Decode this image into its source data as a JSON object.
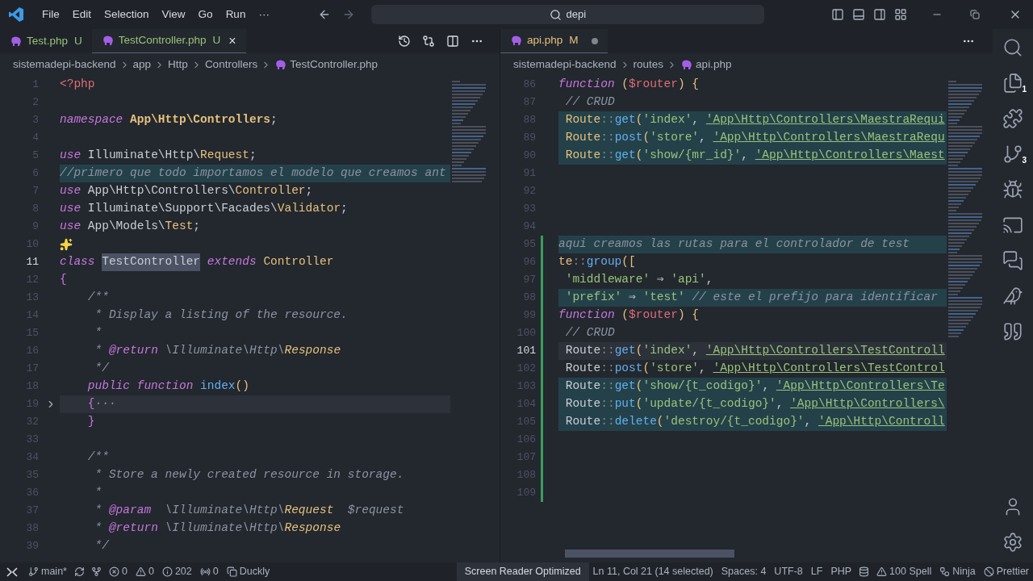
{
  "title_bar": {
    "menu": [
      "File",
      "Edit",
      "Selection",
      "View",
      "Go",
      "Run",
      "···"
    ],
    "search": "depi"
  },
  "left_editor": {
    "tabs": [
      {
        "label": "Test.php",
        "status": "U",
        "selected": false
      },
      {
        "label": "TestController.php",
        "status": "U",
        "selected": true,
        "close": "×"
      }
    ],
    "breadcrumbs": [
      "sistemadepi-backend",
      "app",
      "Http",
      "Controllers",
      "TestController.php"
    ],
    "lines": [
      {
        "number": "1",
        "kind": "code",
        "current": false,
        "highlighted": false,
        "focused": false,
        "tokens": [
          {
            "text": "<?php",
            "kind": "php"
          }
        ]
      },
      {
        "number": "2",
        "kind": "code",
        "current": false,
        "highlighted": false,
        "focused": false
      },
      {
        "number": "3",
        "kind": "code",
        "current": false,
        "highlighted": false,
        "focused": false,
        "tokens": [
          {
            "text": "namespace ",
            "kind": "kw"
          },
          {
            "text": "App\\Http\\Controllers",
            "kind": "ns"
          },
          {
            "text": ";",
            "kind": "punct"
          }
        ]
      },
      {
        "number": "4",
        "kind": "code",
        "current": false,
        "highlighted": false,
        "focused": false
      },
      {
        "number": "5",
        "kind": "code",
        "current": false,
        "highlighted": false,
        "focused": false,
        "tokens": [
          {
            "text": "use ",
            "kind": "kw"
          },
          {
            "text": "Illuminate\\Http\\",
            "kind": "plain"
          },
          {
            "text": "Request",
            "kind": "cls"
          },
          {
            "text": ";",
            "kind": "punct"
          }
        ]
      },
      {
        "number": "6",
        "kind": "code",
        "current": false,
        "highlighted": true,
        "focused": false,
        "tokens": [
          {
            "text": "//primero que todo importamos el modelo que creamos ant",
            "kind": "comment"
          }
        ]
      },
      {
        "number": "7",
        "kind": "code",
        "current": false,
        "highlighted": false,
        "focused": false,
        "tokens": [
          {
            "text": "use ",
            "kind": "kw"
          },
          {
            "text": "App\\Http\\Controllers\\",
            "kind": "plain"
          },
          {
            "text": "Controller",
            "kind": "cls"
          },
          {
            "text": ";",
            "kind": "punct"
          }
        ]
      },
      {
        "number": "8",
        "kind": "code",
        "current": false,
        "highlighted": false,
        "focused": false,
        "tokens": [
          {
            "text": "use ",
            "kind": "kw"
          },
          {
            "text": "Illuminate\\Support\\Facades\\",
            "kind": "plain"
          },
          {
            "text": "Validator",
            "kind": "cls"
          },
          {
            "text": ";",
            "kind": "punct"
          }
        ]
      },
      {
        "number": "9",
        "kind": "code",
        "current": false,
        "highlighted": false,
        "focused": false,
        "tokens": [
          {
            "text": "use ",
            "kind": "kw"
          },
          {
            "text": "App\\Models\\",
            "kind": "plain"
          },
          {
            "text": "Test",
            "kind": "cls"
          },
          {
            "text": ";",
            "kind": "punct"
          }
        ]
      },
      {
        "number": "10",
        "kind": "hint",
        "current": false,
        "highlighted": false,
        "focused": false
      },
      {
        "number": "11",
        "kind": "code",
        "current": true,
        "highlighted": false,
        "focused": false,
        "tokens": [
          {
            "text": "class ",
            "kind": "kw"
          },
          {
            "text": "TestController",
            "kind": "sel"
          },
          {
            "text": " extends ",
            "kind": "kw"
          },
          {
            "text": "Controller",
            "kind": "cls"
          }
        ]
      },
      {
        "number": "12",
        "kind": "code",
        "current": false,
        "highlighted": false,
        "focused": false,
        "tokens": [
          {
            "text": "{",
            "kind": "bracket"
          }
        ]
      },
      {
        "number": "13",
        "kind": "code",
        "current": false,
        "highlighted": false,
        "focused": false,
        "tokens": [
          {
            "text": "    /**",
            "kind": "comment"
          }
        ]
      },
      {
        "number": "14",
        "kind": "code",
        "current": false,
        "highlighted": false,
        "focused": false,
        "tokens": [
          {
            "text": "     * Display a listing of the resource.",
            "kind": "comment"
          }
        ]
      },
      {
        "number": "15",
        "kind": "code",
        "current": false,
        "highlighted": false,
        "focused": false,
        "tokens": [
          {
            "text": "     *",
            "kind": "comment"
          }
        ]
      },
      {
        "number": "16",
        "kind": "code",
        "current": false,
        "highlighted": false,
        "focused": false,
        "tokens": [
          {
            "text": "     * ",
            "kind": "comment"
          },
          {
            "text": "@return",
            "kind": "tag"
          },
          {
            "text": " \\Illuminate\\Http\\",
            "kind": "comment"
          },
          {
            "text": "Response",
            "kind": "doccls"
          }
        ]
      },
      {
        "number": "17",
        "kind": "code",
        "current": false,
        "highlighted": false,
        "focused": false,
        "tokens": [
          {
            "text": "     */",
            "kind": "comment"
          }
        ]
      },
      {
        "number": "18",
        "kind": "code",
        "current": false,
        "highlighted": false,
        "focused": false,
        "tokens": [
          {
            "text": "    public function ",
            "kind": "kw"
          },
          {
            "text": "index",
            "kind": "func"
          },
          {
            "text": "()",
            "kind": "paren"
          }
        ]
      },
      {
        "number": "19",
        "kind": "folded",
        "current": false,
        "highlighted": false,
        "focused": true,
        "tokens": [
          {
            "text": "    {",
            "kind": "bracket"
          },
          {
            "text": "···",
            "kind": "comment"
          }
        ]
      },
      {
        "number": "32",
        "kind": "code",
        "current": false,
        "highlighted": false,
        "focused": false,
        "tokens": [
          {
            "text": "    }",
            "kind": "bracket"
          }
        ]
      },
      {
        "number": "33",
        "kind": "code",
        "current": false,
        "highlighted": false,
        "focused": false
      },
      {
        "number": "34",
        "kind": "code",
        "current": false,
        "highlighted": false,
        "focused": false,
        "tokens": [
          {
            "text": "    /**",
            "kind": "comment"
          }
        ]
      },
      {
        "number": "35",
        "kind": "code",
        "current": false,
        "highlighted": false,
        "focused": false,
        "tokens": [
          {
            "text": "     * Store a newly created resource in storage.",
            "kind": "comment"
          }
        ]
      },
      {
        "number": "36",
        "kind": "code",
        "current": false,
        "highlighted": false,
        "focused": false,
        "tokens": [
          {
            "text": "     *",
            "kind": "comment"
          }
        ]
      },
      {
        "number": "37",
        "kind": "code",
        "current": false,
        "highlighted": false,
        "focused": false,
        "tokens": [
          {
            "text": "     * ",
            "kind": "comment"
          },
          {
            "text": "@param",
            "kind": "tag"
          },
          {
            "text": "  \\Illuminate\\Http\\",
            "kind": "comment"
          },
          {
            "text": "Request",
            "kind": "doccls"
          },
          {
            "text": "  $request",
            "kind": "comment"
          }
        ]
      },
      {
        "number": "38",
        "kind": "code",
        "current": false,
        "highlighted": false,
        "focused": false,
        "tokens": [
          {
            "text": "     * ",
            "kind": "comment"
          },
          {
            "text": "@return",
            "kind": "tag"
          },
          {
            "text": " \\Illuminate\\Http\\",
            "kind": "comment"
          },
          {
            "text": "Response",
            "kind": "doccls"
          }
        ]
      },
      {
        "number": "39",
        "kind": "code",
        "current": false,
        "highlighted": false,
        "focused": false,
        "tokens": [
          {
            "text": "     */",
            "kind": "comment"
          }
        ]
      }
    ]
  },
  "right_editor": {
    "tabs": [
      {
        "label": "api.php",
        "status": "M",
        "selected": true,
        "dirty": true
      }
    ],
    "breadcrumbs": [
      "sistemadepi-backend",
      "routes",
      "api.php"
    ],
    "lines": [
      {
        "number": "86",
        "kind": "code",
        "current": false,
        "highlighted": false,
        "focused": false,
        "modified": false,
        "tokens": [
          {
            "text": "function",
            "kind": "kw"
          },
          {
            "text": " (",
            "kind": "paren"
          },
          {
            "text": "$router",
            "kind": "var"
          },
          {
            "text": ") {",
            "kind": "paren"
          }
        ]
      },
      {
        "number": "87",
        "kind": "code",
        "current": false,
        "highlighted": false,
        "focused": false,
        "modified": false,
        "tokens": [
          {
            "text": " // CRUD",
            "kind": "comment"
          }
        ]
      },
      {
        "number": "88",
        "kind": "code",
        "current": false,
        "highlighted": true,
        "focused": false,
        "modified": false,
        "tokens": [
          {
            "text": " Route",
            "kind": "cls"
          },
          {
            "text": "::",
            "kind": "op"
          },
          {
            "text": "get",
            "kind": "func"
          },
          {
            "text": "(",
            "kind": "paren"
          },
          {
            "text": "'index'",
            "kind": "str"
          },
          {
            "text": ", ",
            "kind": "plain"
          },
          {
            "text": "'App\\Http\\Controllers\\MaestraRequi",
            "kind": "link"
          }
        ]
      },
      {
        "number": "89",
        "kind": "code",
        "current": false,
        "highlighted": true,
        "focused": false,
        "modified": false,
        "tokens": [
          {
            "text": " Route",
            "kind": "cls"
          },
          {
            "text": "::",
            "kind": "op"
          },
          {
            "text": "post",
            "kind": "func"
          },
          {
            "text": "(",
            "kind": "paren"
          },
          {
            "text": "'store'",
            "kind": "str"
          },
          {
            "text": ", ",
            "kind": "plain"
          },
          {
            "text": "'App\\Http\\Controllers\\MaestraRequ",
            "kind": "link"
          }
        ]
      },
      {
        "number": "90",
        "kind": "code",
        "current": false,
        "highlighted": true,
        "focused": false,
        "modified": false,
        "tokens": [
          {
            "text": " Route",
            "kind": "cls"
          },
          {
            "text": "::",
            "kind": "op"
          },
          {
            "text": "get",
            "kind": "func"
          },
          {
            "text": "(",
            "kind": "paren"
          },
          {
            "text": "'show/{mr_id}'",
            "kind": "str"
          },
          {
            "text": ", ",
            "kind": "plain"
          },
          {
            "text": "'App\\Http\\Controllers\\Maest",
            "kind": "link"
          }
        ]
      },
      {
        "number": "91",
        "kind": "code",
        "current": false,
        "highlighted": false,
        "focused": false,
        "modified": false
      },
      {
        "number": "92",
        "kind": "code",
        "current": false,
        "highlighted": false,
        "focused": false,
        "modified": false
      },
      {
        "number": "93",
        "kind": "code",
        "current": false,
        "highlighted": false,
        "focused": false,
        "modified": false
      },
      {
        "number": "94",
        "kind": "code",
        "current": false,
        "highlighted": false,
        "focused": false,
        "modified": false
      },
      {
        "number": "95",
        "kind": "code",
        "current": false,
        "highlighted": true,
        "focused": false,
        "modified": true,
        "tokens": [
          {
            "text": "aqui creamos las rutas para el controlador de test",
            "kind": "comment"
          }
        ]
      },
      {
        "number": "96",
        "kind": "code",
        "current": false,
        "highlighted": false,
        "focused": false,
        "modified": true,
        "tokens": [
          {
            "text": "te",
            "kind": "cls"
          },
          {
            "text": "::",
            "kind": "op"
          },
          {
            "text": "group",
            "kind": "func"
          },
          {
            "text": "([",
            "kind": "paren"
          }
        ]
      },
      {
        "number": "97",
        "kind": "code",
        "current": false,
        "highlighted": false,
        "focused": false,
        "modified": true,
        "tokens": [
          {
            "text": " 'middleware'",
            "kind": "str"
          },
          {
            "text": " ⇒ ",
            "kind": "plain"
          },
          {
            "text": "'api'",
            "kind": "str"
          },
          {
            "text": ",",
            "kind": "plain"
          }
        ]
      },
      {
        "number": "98",
        "kind": "code",
        "current": false,
        "highlighted": true,
        "focused": false,
        "modified": true,
        "tokens": [
          {
            "text": " 'prefix'",
            "kind": "str"
          },
          {
            "text": " ⇒ ",
            "kind": "plain"
          },
          {
            "text": "'test'",
            "kind": "str"
          },
          {
            "text": " // este el prefijo para identificar",
            "kind": "comment"
          }
        ]
      },
      {
        "number": "99",
        "kind": "code",
        "current": false,
        "highlighted": false,
        "focused": false,
        "modified": true,
        "tokens": [
          {
            "text": "function",
            "kind": "kw"
          },
          {
            "text": " (",
            "kind": "paren"
          },
          {
            "text": "$router",
            "kind": "var"
          },
          {
            "text": ") {",
            "kind": "paren"
          }
        ]
      },
      {
        "number": "100",
        "kind": "code",
        "current": false,
        "highlighted": false,
        "focused": false,
        "modified": true,
        "tokens": [
          {
            "text": " // CRUD",
            "kind": "comment"
          }
        ]
      },
      {
        "number": "101",
        "kind": "code",
        "current": true,
        "highlighted": false,
        "focused": true,
        "modified": true,
        "tokens": [
          {
            "text": " Route",
            "kind": "plain"
          },
          {
            "text": "::",
            "kind": "op"
          },
          {
            "text": "get",
            "kind": "func"
          },
          {
            "text": "(",
            "kind": "paren"
          },
          {
            "text": "'index'",
            "kind": "str"
          },
          {
            "text": ", ",
            "kind": "plain"
          },
          {
            "text": "'App\\Http\\Controllers\\TestControll",
            "kind": "link"
          }
        ]
      },
      {
        "number": "102",
        "kind": "code",
        "current": false,
        "highlighted": false,
        "focused": false,
        "modified": true,
        "tokens": [
          {
            "text": " Route",
            "kind": "plain"
          },
          {
            "text": "::",
            "kind": "op"
          },
          {
            "text": "post",
            "kind": "func"
          },
          {
            "text": "(",
            "kind": "paren"
          },
          {
            "text": "'store'",
            "kind": "str"
          },
          {
            "text": ", ",
            "kind": "plain"
          },
          {
            "text": "'App\\Http\\Controllers\\TestControl",
            "kind": "link"
          }
        ]
      },
      {
        "number": "103",
        "kind": "code",
        "current": false,
        "highlighted": true,
        "focused": false,
        "modified": true,
        "tokens": [
          {
            "text": " Route",
            "kind": "plain"
          },
          {
            "text": "::",
            "kind": "op"
          },
          {
            "text": "get",
            "kind": "func"
          },
          {
            "text": "(",
            "kind": "paren"
          },
          {
            "text": "'show/{t_codigo}'",
            "kind": "str"
          },
          {
            "text": ", ",
            "kind": "plain"
          },
          {
            "text": "'App\\Http\\Controllers\\Te",
            "kind": "link"
          }
        ]
      },
      {
        "number": "104",
        "kind": "code",
        "current": false,
        "highlighted": true,
        "focused": false,
        "modified": true,
        "tokens": [
          {
            "text": " Route",
            "kind": "plain"
          },
          {
            "text": "::",
            "kind": "op"
          },
          {
            "text": "put",
            "kind": "func"
          },
          {
            "text": "(",
            "kind": "paren"
          },
          {
            "text": "'update/{t_codigo}'",
            "kind": "str"
          },
          {
            "text": ", ",
            "kind": "plain"
          },
          {
            "text": "'App\\Http\\Controllers\\",
            "kind": "link"
          }
        ]
      },
      {
        "number": "105",
        "kind": "code",
        "current": false,
        "highlighted": true,
        "focused": false,
        "modified": true,
        "tokens": [
          {
            "text": " Route",
            "kind": "plain"
          },
          {
            "text": "::",
            "kind": "op"
          },
          {
            "text": "delete",
            "kind": "func"
          },
          {
            "text": "(",
            "kind": "paren"
          },
          {
            "text": "'destroy/{t_codigo}'",
            "kind": "str"
          },
          {
            "text": ", ",
            "kind": "plain"
          },
          {
            "text": "'App\\Http\\Controll",
            "kind": "link"
          }
        ]
      },
      {
        "number": "106",
        "kind": "code",
        "current": false,
        "highlighted": false,
        "focused": false,
        "modified": true
      },
      {
        "number": "107",
        "kind": "code",
        "current": false,
        "highlighted": false,
        "focused": false,
        "modified": true
      },
      {
        "number": "108",
        "kind": "code",
        "current": false,
        "highlighted": false,
        "focused": false,
        "modified": true
      },
      {
        "number": "109",
        "kind": "code",
        "current": false,
        "highlighted": false,
        "focused": false,
        "modified": true
      }
    ]
  },
  "activity_bar": {
    "badges": [
      {
        "kind": "explorer",
        "count": "1"
      },
      {
        "kind": "source_control",
        "count": "3"
      }
    ]
  },
  "status_bar": {
    "left": [
      {
        "kind": "remote"
      },
      {
        "kind": "branch",
        "text": "main*"
      },
      {
        "kind": "sync"
      },
      {
        "kind": "graph"
      },
      {
        "kind": "error",
        "text": "0"
      },
      {
        "kind": "warning",
        "text": "0"
      },
      {
        "kind": "info",
        "text": "202"
      },
      {
        "kind": "ports",
        "text": "0"
      },
      {
        "kind": "share",
        "text": "Duckly"
      }
    ],
    "right": [
      {
        "kind": "highlight",
        "text": "Screen Reader Optimized"
      },
      {
        "kind": "text",
        "text": "Ln 11, Col 21 (14 selected)"
      },
      {
        "kind": "text",
        "text": "Spaces: 4"
      },
      {
        "kind": "text",
        "text": "UTF-8"
      },
      {
        "kind": "text",
        "text": "LF"
      },
      {
        "kind": "text",
        "text": "PHP"
      },
      {
        "kind": "db"
      },
      {
        "kind": "warning",
        "text": "100 Spell"
      },
      {
        "kind": "ninja",
        "text": "Ninja"
      },
      {
        "kind": "prettier",
        "text": "Prettier"
      }
    ]
  }
}
